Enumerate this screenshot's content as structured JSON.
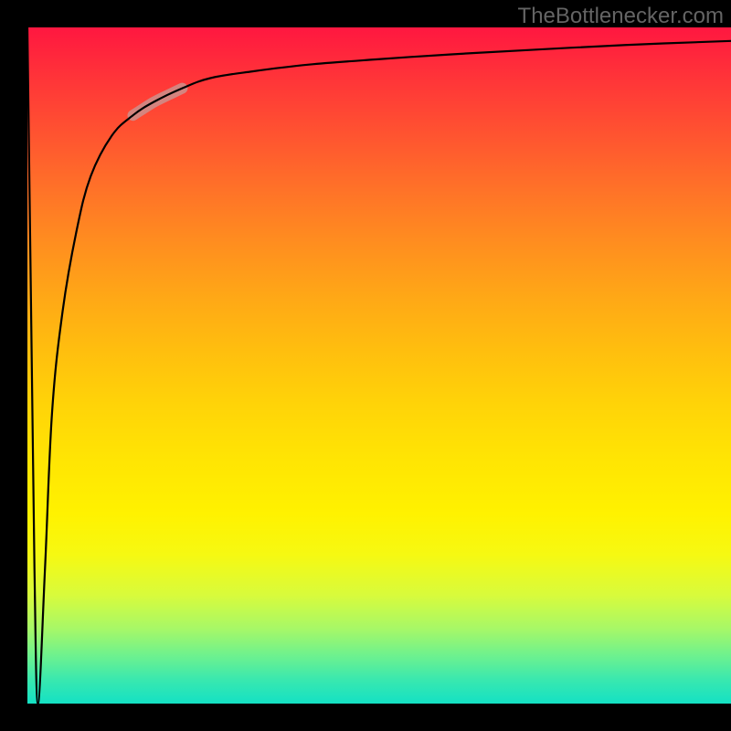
{
  "watermark": {
    "text": "TheBottlenecker.com"
  },
  "chart_data": {
    "type": "line",
    "title": "",
    "xlabel": "",
    "ylabel": "",
    "xlim": [
      0,
      100
    ],
    "ylim": [
      0,
      100
    ],
    "x": [
      0,
      0.5,
      1.0,
      1.5,
      2.5,
      3.5,
      5,
      7,
      9,
      12,
      15,
      18,
      22,
      26,
      32,
      40,
      50,
      60,
      72,
      85,
      100
    ],
    "y": [
      100,
      60,
      20,
      0,
      20,
      43,
      58,
      70,
      78,
      84,
      87,
      89,
      91,
      92.5,
      93.5,
      94.5,
      95.3,
      96.0,
      96.7,
      97.4,
      98.0
    ],
    "highlight_segment": {
      "x0": 15,
      "x1": 22
    },
    "series_color": "#000000",
    "highlight_color": "#cf8c87",
    "background_gradient": [
      "#ff1740",
      "#ff8e1f",
      "#fff200",
      "#14e1c4"
    ]
  }
}
